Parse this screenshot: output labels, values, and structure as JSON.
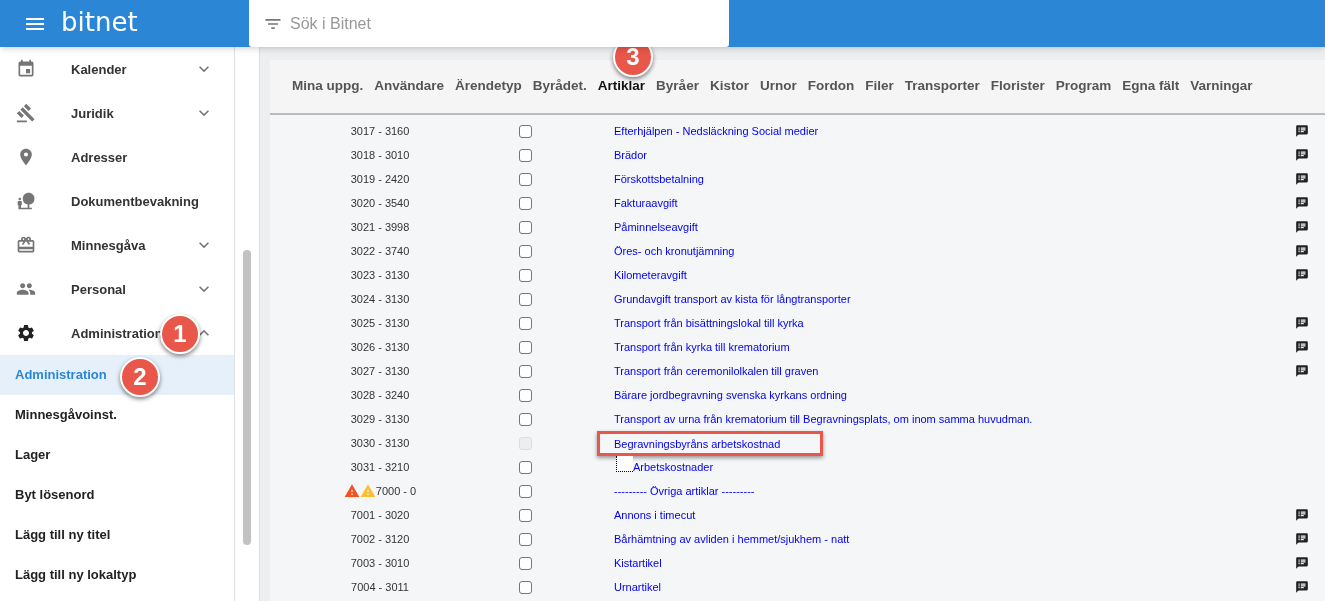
{
  "app_bar": {
    "logo": "bitnet",
    "search": {
      "placeholder": "Sök i Bitnet"
    }
  },
  "sidebar": {
    "items": [
      {
        "kind": "calendar",
        "label": "Kalender",
        "expandable": true,
        "expanded": false
      },
      {
        "kind": "gavel",
        "label": "Juridik",
        "expandable": true,
        "expanded": false
      },
      {
        "kind": "place",
        "label": "Adresser",
        "expandable": false
      },
      {
        "kind": "nature",
        "label": "Dokumentbevakning",
        "expandable": false
      },
      {
        "kind": "gift",
        "label": "Minnesgåva",
        "expandable": true,
        "expanded": false
      },
      {
        "kind": "people",
        "label": "Personal",
        "expandable": true,
        "expanded": false
      },
      {
        "kind": "settings",
        "label": "Administration",
        "expandable": true,
        "expanded": true
      }
    ],
    "sub_items": [
      {
        "label": "Administration",
        "selected": true
      },
      {
        "label": "Minnesgåvoinst.",
        "selected": false
      },
      {
        "label": "Lager",
        "selected": false
      },
      {
        "label": "Byt lösenord",
        "selected": false
      },
      {
        "label": "Lägg till ny titel",
        "selected": false
      },
      {
        "label": "Lägg till ny lokaltyp",
        "selected": false
      }
    ]
  },
  "tabs": [
    {
      "label": "Mina uppg.",
      "selected": false
    },
    {
      "label": "Användare",
      "selected": false
    },
    {
      "label": "Ärendetyp",
      "selected": false
    },
    {
      "label": "Byrådet.",
      "selected": false
    },
    {
      "label": "Artiklar",
      "selected": true
    },
    {
      "label": "Byråer",
      "selected": false
    },
    {
      "label": "Kistor",
      "selected": false
    },
    {
      "label": "Urnor",
      "selected": false
    },
    {
      "label": "Fordon",
      "selected": false
    },
    {
      "label": "Filer",
      "selected": false
    },
    {
      "label": "Transporter",
      "selected": false
    },
    {
      "label": "Florister",
      "selected": false
    },
    {
      "label": "Program",
      "selected": false
    },
    {
      "label": "Egna fält",
      "selected": false
    },
    {
      "label": "Varningar",
      "selected": false
    }
  ],
  "rows": [
    {
      "number": "3017 - 3160",
      "checked": false,
      "disabled": false,
      "name": "Efterhjälpen - Nedsläckning Social medier",
      "comment": true
    },
    {
      "number": "3018 - 3010",
      "checked": false,
      "disabled": false,
      "name": "Brädor",
      "comment": true
    },
    {
      "number": "3019 - 2420",
      "checked": false,
      "disabled": false,
      "name": "Förskottsbetalning",
      "comment": true
    },
    {
      "number": "3020 - 3540",
      "checked": false,
      "disabled": false,
      "name": "Fakturaavgift",
      "comment": true
    },
    {
      "number": "3021 - 3998",
      "checked": false,
      "disabled": false,
      "name": "Påminnelseavgift",
      "comment": true
    },
    {
      "number": "3022 - 3740",
      "checked": false,
      "disabled": false,
      "name": "Öres- och kronutjämning",
      "comment": true
    },
    {
      "number": "3023 - 3130",
      "checked": false,
      "disabled": false,
      "name": "Kilometeravgift",
      "comment": true
    },
    {
      "number": "3024 - 3130",
      "checked": false,
      "disabled": false,
      "name": "Grundavgift transport av kista för långtransporter",
      "comment": false
    },
    {
      "number": "3025 - 3130",
      "checked": false,
      "disabled": false,
      "name": "Transport från bisättningslokal till kyrka",
      "comment": true
    },
    {
      "number": "3026 - 3130",
      "checked": false,
      "disabled": false,
      "name": "Transport från kyrka till krematorium",
      "comment": true
    },
    {
      "number": "3027 - 3130",
      "checked": false,
      "disabled": false,
      "name": "Transport från ceremonilolkalen till graven",
      "comment": true
    },
    {
      "number": "3028 - 3240",
      "checked": false,
      "disabled": false,
      "name": "Bärare jordbegravning svenska kyrkans ordning",
      "comment": false
    },
    {
      "number": "3029 - 3130",
      "checked": false,
      "disabled": false,
      "name": "Transport av urna från krematorium till Begravningsplats, om inom samma huvudman.",
      "comment": false
    },
    {
      "number": "3030 - 3130",
      "checked": false,
      "disabled": true,
      "highlighted": true,
      "name": "Begravningsbyråns arbetskostnad",
      "comment": false,
      "children": [
        {
          "number": "3031 - 3210",
          "checked": false,
          "disabled": false,
          "name": "Arbetskostnader",
          "comment": false
        }
      ]
    },
    {
      "number": "7000 - 0",
      "checked": false,
      "disabled": false,
      "name": "--------- Övriga artiklar ---------",
      "comment": false,
      "warnings": [
        {
          "color": "#f4511e"
        },
        {
          "color": "#fbc02d"
        }
      ]
    },
    {
      "number": "7001 - 3020",
      "checked": false,
      "disabled": false,
      "name": "Annons i timecut",
      "comment": true
    },
    {
      "number": "7002 - 3120",
      "checked": false,
      "disabled": false,
      "name": "Bårhämtning av avliden i hemmet/sjukhem - natt",
      "comment": true
    },
    {
      "number": "7003 - 3010",
      "checked": false,
      "disabled": false,
      "name": "Kistartikel",
      "comment": true
    },
    {
      "number": "7004 - 3011",
      "checked": false,
      "disabled": false,
      "name": "Urnartikel",
      "comment": true
    }
  ],
  "callouts": [
    "1",
    "2",
    "3"
  ]
}
